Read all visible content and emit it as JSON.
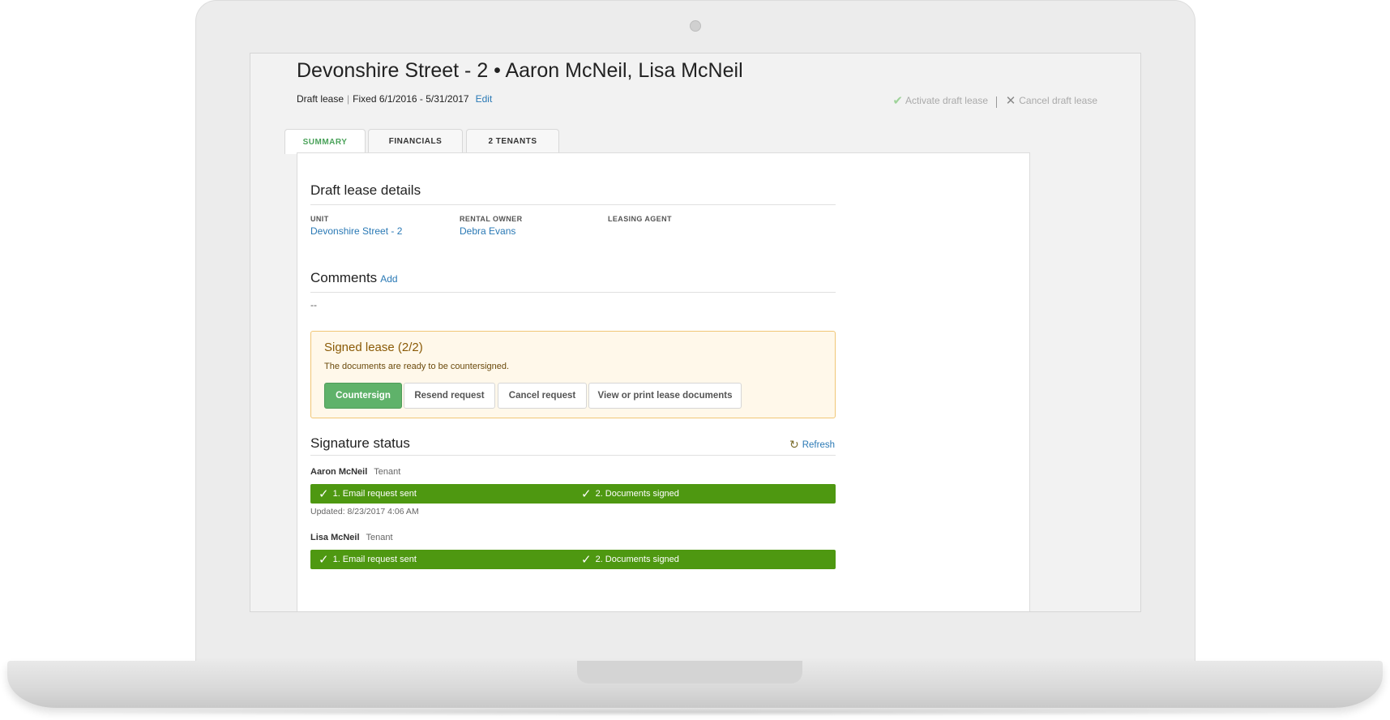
{
  "header": {
    "title": "Devonshire Street - 2 • Aaron McNeil, Lisa McNeil",
    "status": "Draft lease",
    "term": "Fixed 6/1/2016 - 5/31/2017",
    "edit_label": "Edit",
    "activate_label": "Activate draft lease",
    "cancel_label": "Cancel draft lease"
  },
  "tabs": [
    {
      "label": "SUMMARY",
      "active": true
    },
    {
      "label": "FINANCIALS",
      "active": false
    },
    {
      "label": "2 TENANTS",
      "active": false
    }
  ],
  "details": {
    "heading": "Draft lease details",
    "unit_label": "UNIT",
    "unit_value": "Devonshire Street - 2",
    "owner_label": "RENTAL OWNER",
    "owner_value": "Debra Evans",
    "agent_label": "LEASING AGENT"
  },
  "comments": {
    "heading": "Comments",
    "add_label": "Add",
    "value": "--"
  },
  "alert": {
    "title": "Signed lease (2/2)",
    "message": "The documents are ready to be countersigned.",
    "buttons": {
      "countersign": "Countersign",
      "resend": "Resend request",
      "cancel": "Cancel request",
      "view": "View or print lease documents"
    }
  },
  "signature": {
    "heading": "Signature status",
    "refresh_label": "Refresh",
    "signers": [
      {
        "name": "Aaron McNeil",
        "role": "Tenant",
        "step1": "1. Email request sent",
        "step2": "2. Documents signed",
        "updated": "Updated: 8/23/2017 4:06 AM"
      },
      {
        "name": "Lisa McNeil",
        "role": "Tenant",
        "step1": "1. Email request sent",
        "step2": "2. Documents signed"
      }
    ]
  },
  "colors": {
    "accent_green": "#5fb26a",
    "progress_green": "#4e9811",
    "link_blue": "#2a79b5",
    "alert_border": "#f0c676"
  }
}
